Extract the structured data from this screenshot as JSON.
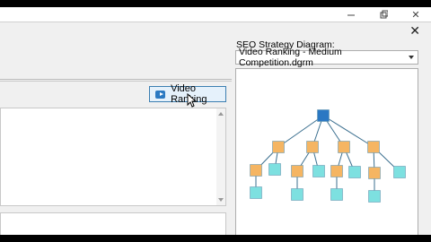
{
  "window": {
    "controls": [
      "minimize",
      "maximize",
      "close"
    ],
    "close_glyph": "✕",
    "dialog_close_glyph": "✕"
  },
  "left": {
    "video_button_label": "Video Ranking",
    "video_button_icon": "video-icon"
  },
  "right": {
    "title": "SEO Strategy Diagram:",
    "selected_diagram": "Video Ranking - Medium Competition.dgrm"
  },
  "diagram": {
    "colors": {
      "root": "#2b78c3",
      "orange": "#f5b562",
      "cyan": "#7de0e0",
      "line": "#3b6f8f"
    },
    "root": "root",
    "levels": [
      [
        "root"
      ],
      [
        "n1",
        "n2",
        "n3",
        "n4"
      ],
      [
        "a1",
        "a2",
        "b1",
        "b2",
        "c1",
        "c2",
        "d1",
        "d2"
      ],
      [
        "a1c",
        "b1c",
        "c1c",
        "d1c"
      ]
    ],
    "edges": [
      [
        "root",
        "n1"
      ],
      [
        "root",
        "n2"
      ],
      [
        "root",
        "n3"
      ],
      [
        "root",
        "n4"
      ],
      [
        "n1",
        "a1"
      ],
      [
        "n1",
        "a2"
      ],
      [
        "n2",
        "b1"
      ],
      [
        "n2",
        "b2"
      ],
      [
        "n3",
        "c1"
      ],
      [
        "n3",
        "c2"
      ],
      [
        "n4",
        "d1"
      ],
      [
        "n4",
        "d2"
      ],
      [
        "a1",
        "a1c"
      ],
      [
        "b1",
        "b1c"
      ],
      [
        "c1",
        "c1c"
      ],
      [
        "d1",
        "d1c"
      ]
    ],
    "node_colors": {
      "root": "root",
      "n1": "orange",
      "n2": "orange",
      "n3": "orange",
      "n4": "orange",
      "a1": "orange",
      "a2": "cyan",
      "b1": "orange",
      "b2": "cyan",
      "c1": "orange",
      "c2": "cyan",
      "d1": "orange",
      "d2": "cyan",
      "a1c": "cyan",
      "b1c": "cyan",
      "c1c": "cyan",
      "d1c": "cyan"
    }
  }
}
